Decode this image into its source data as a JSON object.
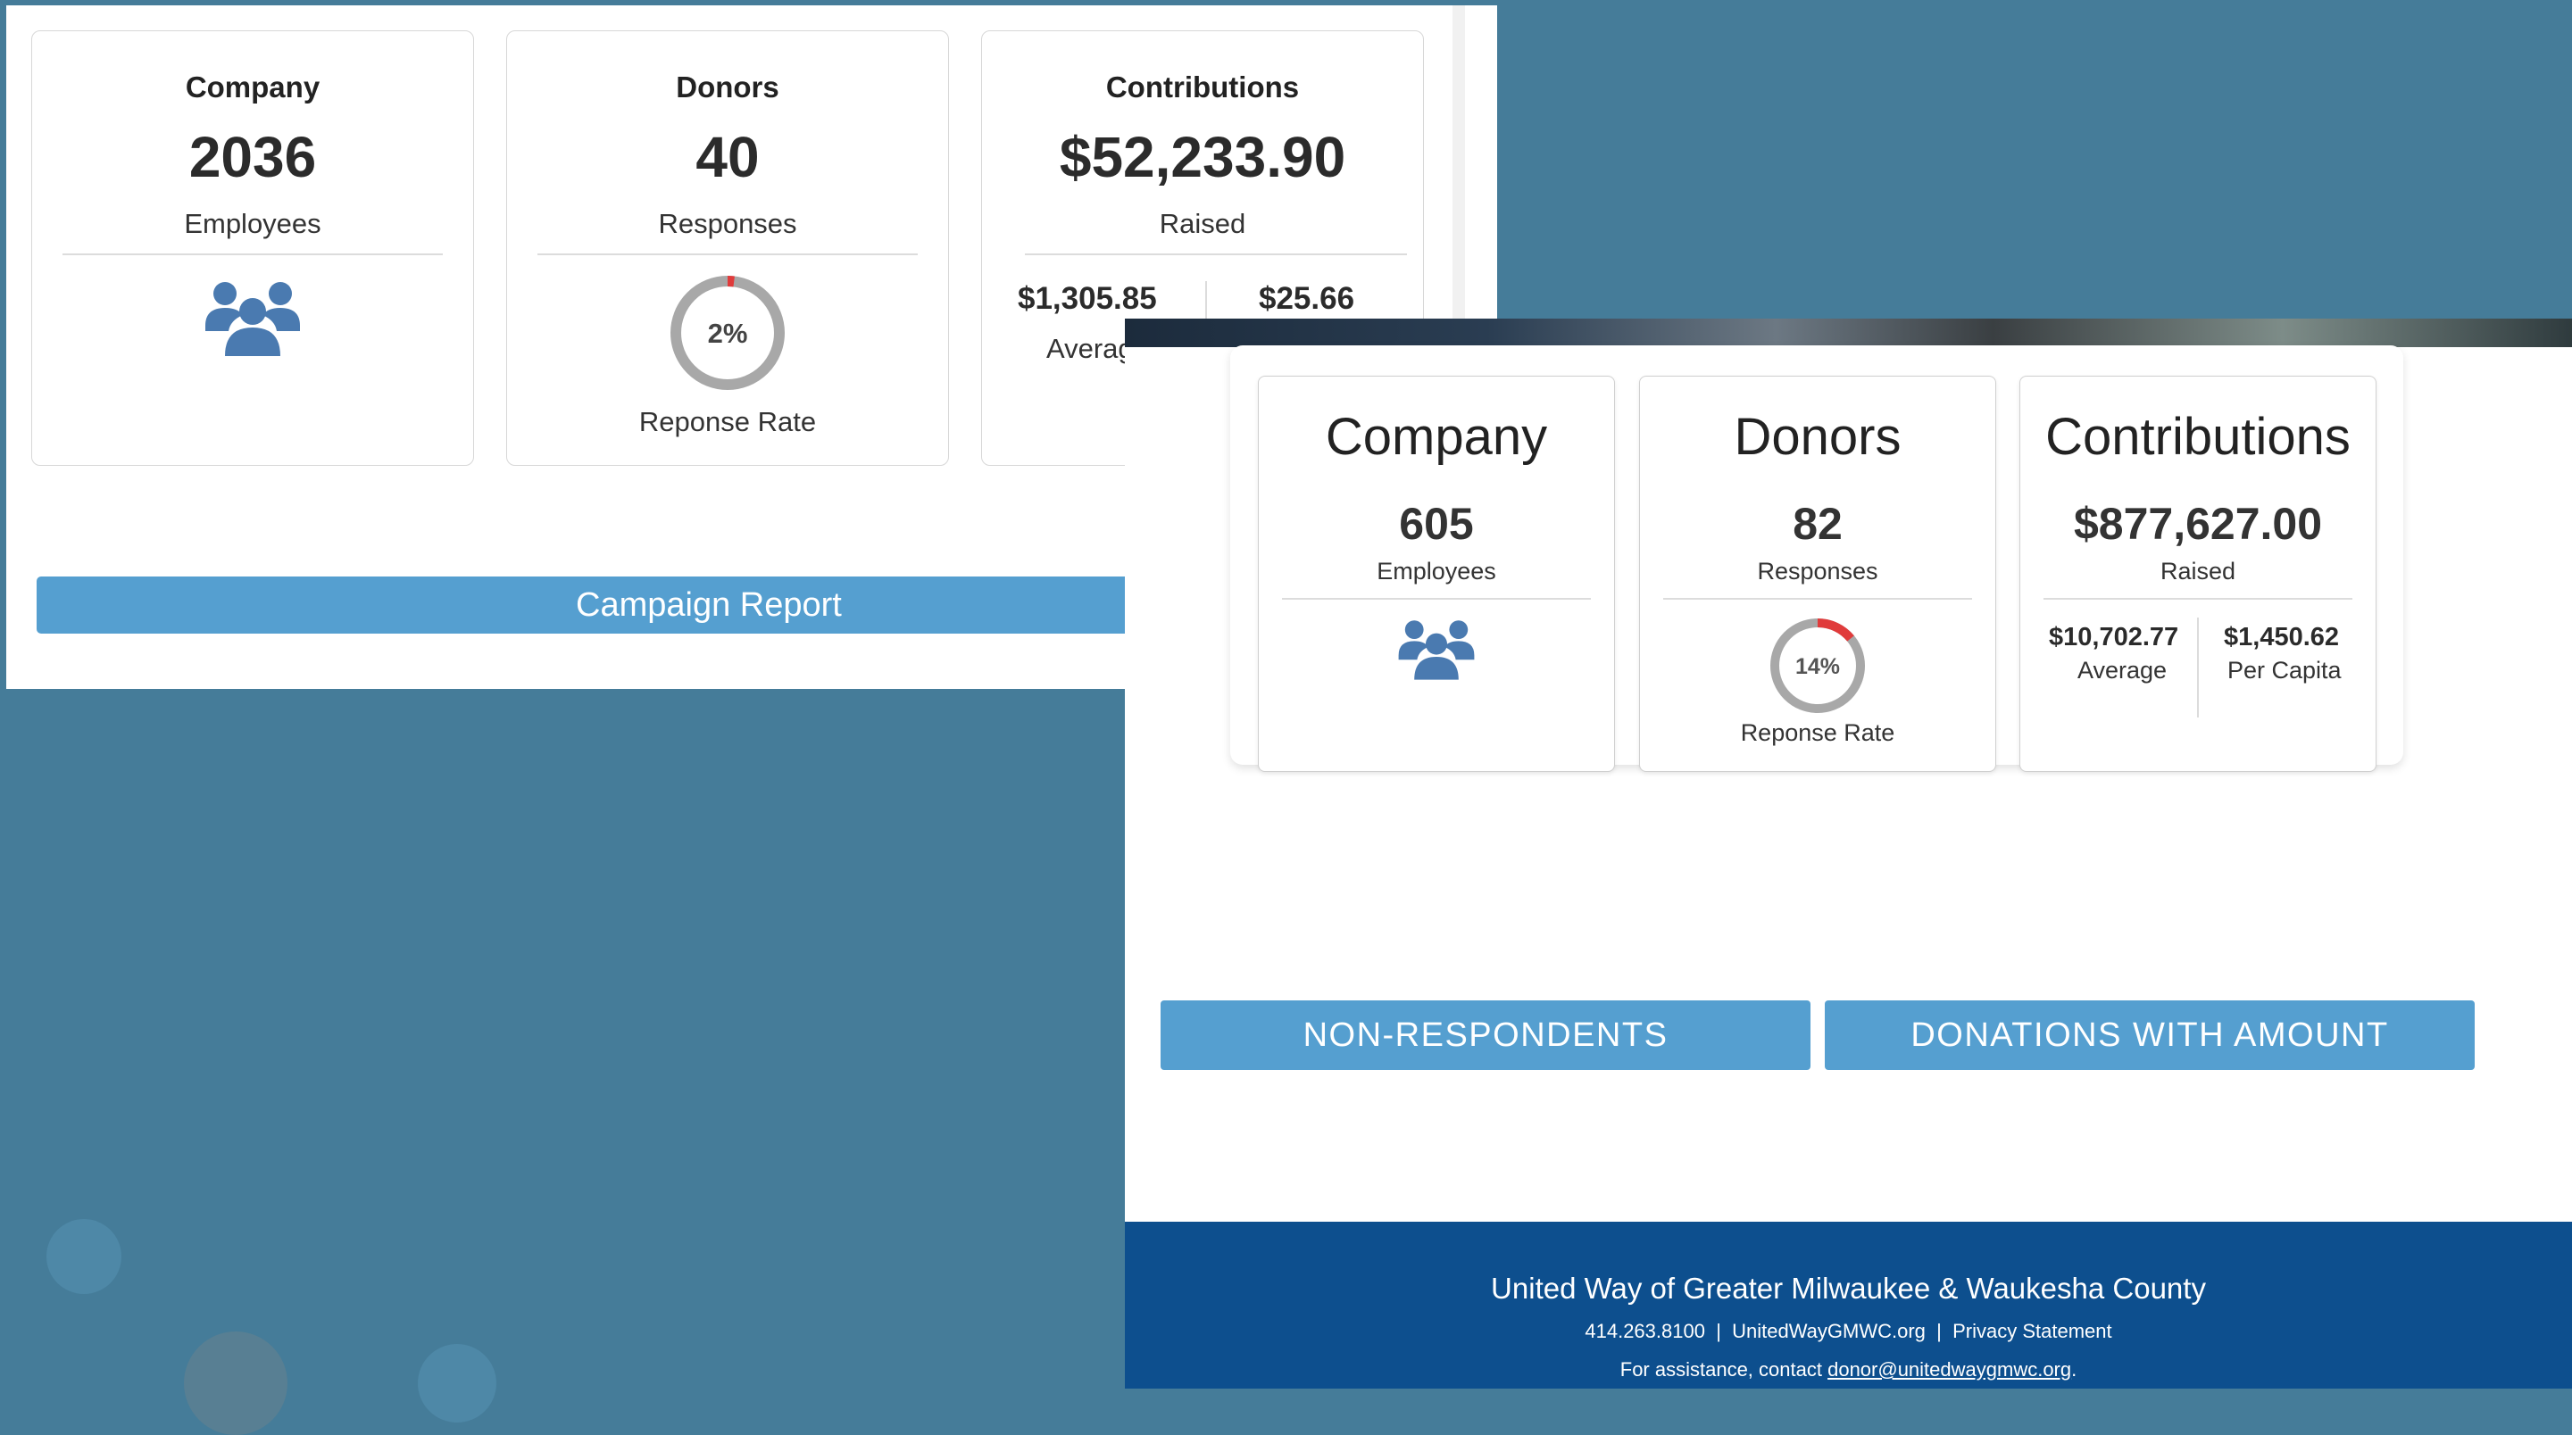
{
  "panel_a": {
    "company": {
      "title": "Company",
      "value": "2036",
      "label": "Employees"
    },
    "donors": {
      "title": "Donors",
      "value": "40",
      "label": "Responses",
      "rate_text": "2%",
      "rate_fraction": 0.02,
      "caption": "Reponse Rate"
    },
    "contributions": {
      "title": "Contributions",
      "value": "$52,233.90",
      "label": "Raised",
      "average": "$1,305.85",
      "average_label": "Averag",
      "per_capita": "$25.66"
    },
    "report_button": "Campaign Report"
  },
  "panel_b": {
    "company": {
      "title": "Company",
      "value": "605",
      "label": "Employees"
    },
    "donors": {
      "title": "Donors",
      "value": "82",
      "label": "Responses",
      "rate_text": "14%",
      "rate_fraction": 0.14,
      "caption": "Reponse Rate"
    },
    "contributions": {
      "title": "Contributions",
      "value": "$877,627.00",
      "label": "Raised",
      "average": "$10,702.77",
      "average_label": "Average",
      "per_capita": "$1,450.62",
      "per_capita_label": "Per Capita"
    },
    "buttons": {
      "non_respondents": "NON-RESPONDENTS",
      "donations": "DONATIONS WITH AMOUNT"
    },
    "footer": {
      "org": "United Way of Greater Milwaukee & Waukesha County",
      "phone": "414.263.8100",
      "site": "UnitedWayGMWC.org",
      "privacy": "Privacy Statement",
      "separator": "|",
      "assist_prefix": "For assistance, contact",
      "email": "donor@unitedwaygmwc.org",
      "assist_suffix": "."
    }
  },
  "icons": {
    "people": "people-group-icon",
    "ring": "response-rate-ring"
  },
  "colors": {
    "background": "#457c99",
    "button": "#559fd0",
    "footer": "#0d4f8e",
    "icon": "#4a7ab0",
    "ring_track": "#a8a8a8",
    "ring_fill": "#e03b3b"
  }
}
